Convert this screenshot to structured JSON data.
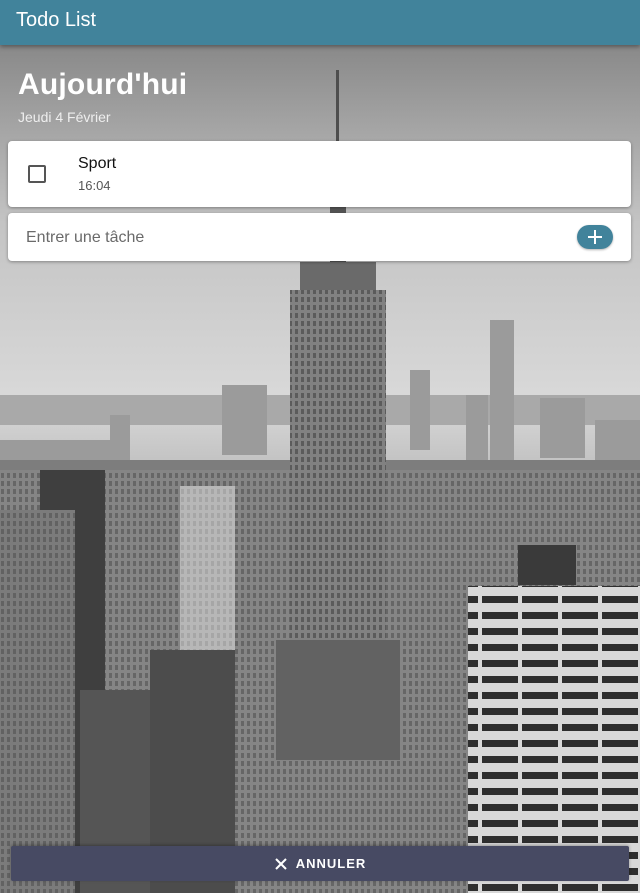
{
  "app": {
    "title": "Todo List"
  },
  "header": {
    "title": "Aujourd'hui",
    "date": "Jeudi 4 Février"
  },
  "tasks": [
    {
      "name": "Sport",
      "time": "16:04",
      "done": false
    }
  ],
  "new_task": {
    "placeholder": "Entrer une tâche",
    "value": "",
    "add_icon": "plus-icon"
  },
  "footer": {
    "cancel_label": "ANNULER",
    "cancel_icon": "close-icon"
  },
  "colors": {
    "app_bar": "#41839b",
    "add_button": "#41839b",
    "cancel_bar": "#474a63"
  }
}
